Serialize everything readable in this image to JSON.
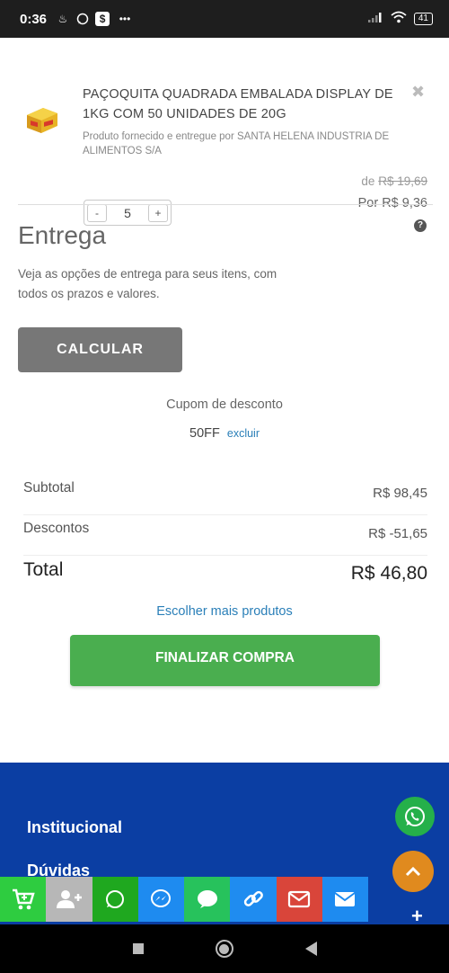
{
  "status_bar": {
    "time": "0:36",
    "left_icons": [
      "steam-icon",
      "whatsapp-icon",
      "dollar-app-icon",
      "more-dots-icon"
    ],
    "battery": "41"
  },
  "product": {
    "title": "PAÇOQUITA QUADRADA EMBALADA DISPLAY DE 1KG COM 50 UNIDADES DE 20G",
    "supplier": "Produto fornecido e entregue por SANTA HELENA INDUSTRIA DE ALIMENTOS S/A",
    "price_old_prefix": "de",
    "price_old": "R$ 19,69",
    "price_new": "Por R$ 9,36",
    "quantity": "5",
    "qty_minus": "-",
    "qty_plus": "+",
    "help": "?"
  },
  "entrega": {
    "title": "Entrega",
    "description": "Veja as opções de entrega para seus itens, com todos os prazos e valores.",
    "button": "CALCULAR"
  },
  "cupom": {
    "label": "Cupom de desconto",
    "code": "50FF",
    "remove": "excluir"
  },
  "summary": {
    "subtotal_label": "Subtotal",
    "subtotal_value": "R$ 98,45",
    "discount_label": "Descontos",
    "discount_value": "R$ -51,65",
    "total_label": "Total",
    "total_value": "R$ 46,80"
  },
  "actions": {
    "more_products": "Escolher mais produtos",
    "finish": "FINALIZAR COMPRA"
  },
  "footer": {
    "links": [
      "Institucional",
      "Dúvidas"
    ]
  },
  "share_bar": [
    {
      "icon": "cart-add-icon",
      "color": "#2ecc40"
    },
    {
      "icon": "add-user-icon",
      "color": "#b7b7b7"
    },
    {
      "icon": "whatsapp-icon",
      "color": "#1fa81f"
    },
    {
      "icon": "messenger-icon",
      "color": "#1e8bf0"
    },
    {
      "icon": "sms-icon",
      "color": "#27c25c"
    },
    {
      "icon": "link-icon",
      "color": "#1f8cf0"
    },
    {
      "icon": "gmail-icon",
      "color": "#d9453a"
    },
    {
      "icon": "email-icon",
      "color": "#1e8bf0"
    }
  ],
  "colors": {
    "footer_bg": "#0b3ea3",
    "finish_btn": "#4aae4f",
    "calc_btn": "#777777",
    "link": "#2a7fb8"
  }
}
